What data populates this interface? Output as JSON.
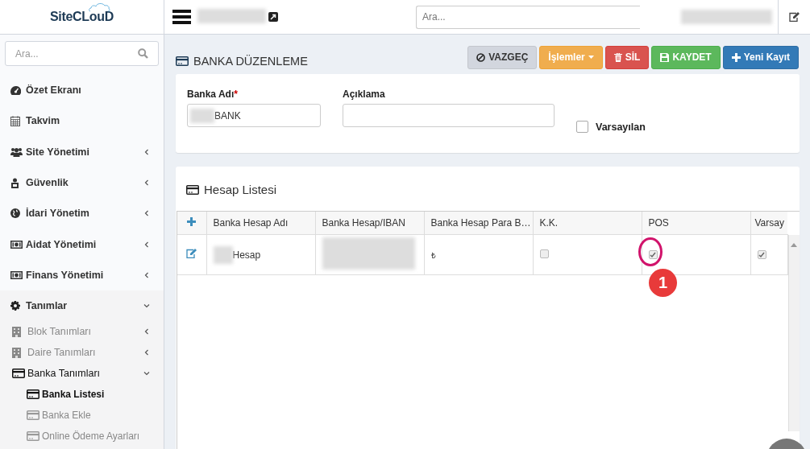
{
  "logo": {
    "text": "SiteCLouD"
  },
  "topbar": {
    "search": {
      "placeholder": "Ara..."
    }
  },
  "sidebar": {
    "search": {
      "placeholder": "Ara..."
    },
    "items": [
      {
        "label": "Özet Ekranı",
        "has_children": false
      },
      {
        "label": "Takvim",
        "has_children": false
      },
      {
        "label": "Site Yönetimi",
        "has_children": true,
        "expanded": false
      },
      {
        "label": "Güvenlik",
        "has_children": true,
        "expanded": false
      },
      {
        "label": "İdari Yönetim",
        "has_children": true,
        "expanded": false
      },
      {
        "label": "Aidat Yönetimi",
        "has_children": true,
        "expanded": false
      },
      {
        "label": "Finans Yönetimi",
        "has_children": true,
        "expanded": false
      },
      {
        "label": "Tanımlar",
        "has_children": true,
        "expanded": true,
        "children": [
          {
            "label": "Blok Tanımları",
            "has_children": true,
            "expanded": false
          },
          {
            "label": "Daire Tanımları",
            "has_children": true,
            "expanded": false
          },
          {
            "label": "Banka Tanımları",
            "has_children": true,
            "expanded": true,
            "children": [
              {
                "label": "Banka Listesi",
                "selected": true
              },
              {
                "label": "Banka Ekle",
                "selected": false
              },
              {
                "label": "Online Ödeme Ayarları",
                "selected": false
              }
            ]
          }
        ]
      }
    ]
  },
  "page": {
    "title": "BANKA DÜZENLEME",
    "buttons": [
      {
        "label": "VAZGEÇ",
        "kind": "default",
        "dropdown": false
      },
      {
        "label": "İşlemler",
        "kind": "warning",
        "dropdown": true
      },
      {
        "label": "SİL",
        "kind": "danger",
        "dropdown": false
      },
      {
        "label": "KAYDET",
        "kind": "success",
        "dropdown": false
      },
      {
        "label": "Yeni Kayıt",
        "kind": "primary",
        "dropdown": false
      }
    ]
  },
  "form": {
    "bank_name": {
      "label": "Banka Adı",
      "required_mark": "*",
      "value": "BANK"
    },
    "description": {
      "label": "Açıklama"
    },
    "default": {
      "label": "Varsayılan",
      "checked": false
    }
  },
  "accounts": {
    "title": "Hesap Listesi",
    "columns": [
      "Banka Hesap Adı",
      "Banka Hesap/IBAN",
      "Banka Hesap Para B…",
      "K.K.",
      "POS",
      "Varsay"
    ],
    "rows": [
      {
        "name": "Hesap",
        "currency": "₺",
        "kk": false,
        "pos": true,
        "default": true
      }
    ],
    "annotation": {
      "label": "1"
    }
  }
}
